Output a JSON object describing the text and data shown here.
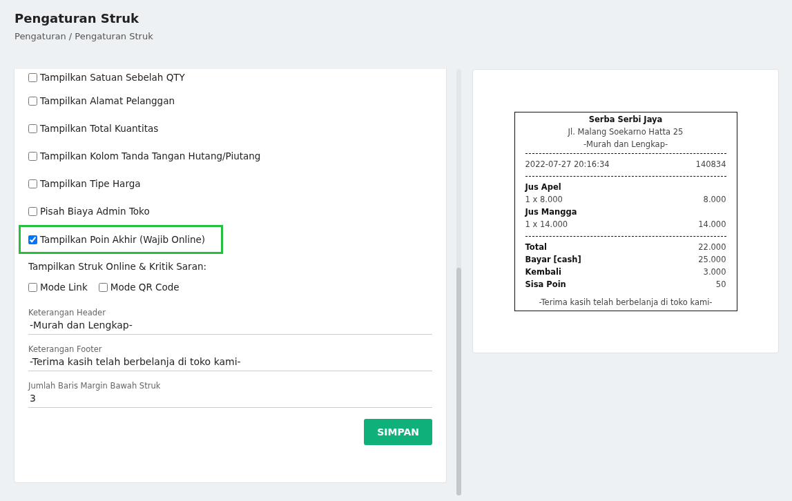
{
  "page": {
    "title": "Pengaturan Struk",
    "breadcrumb": "Pengaturan / Pengaturan Struk"
  },
  "options": [
    {
      "label": "Tampilkan Satuan Sebelah QTY",
      "checked": false,
      "highlighted": false
    },
    {
      "label": "Tampilkan Alamat Pelanggan",
      "checked": false,
      "highlighted": false
    },
    {
      "label": "Tampilkan Total Kuantitas",
      "checked": false,
      "highlighted": false
    },
    {
      "label": "Tampilkan Kolom Tanda Tangan Hutang/Piutang",
      "checked": false,
      "highlighted": false
    },
    {
      "label": "Tampilkan Tipe Harga",
      "checked": false,
      "highlighted": false
    },
    {
      "label": "Pisah Biaya Admin Toko",
      "checked": false,
      "highlighted": false
    },
    {
      "label": "Tampilkan Poin Akhir (Wajib Online)",
      "checked": true,
      "highlighted": true
    }
  ],
  "online_section": {
    "label": "Tampilkan Struk Online & Kritik Saran:",
    "modes": [
      {
        "label": "Mode Link",
        "checked": false
      },
      {
        "label": "Mode QR Code",
        "checked": false
      }
    ]
  },
  "fields": [
    {
      "label": "Keterangan Header",
      "value": "-Murah dan Lengkap-"
    },
    {
      "label": "Keterangan Footer",
      "value": "-Terima kasih telah berbelanja di toko kami-"
    },
    {
      "label": "Jumlah Baris Margin Bawah Struk",
      "value": "3"
    }
  ],
  "save_button": "SIMPAN",
  "receipt": {
    "store_name": "Serba Serbi Jaya",
    "address": "Jl. Malang Soekarno Hatta 25",
    "header_note": "-Murah dan Lengkap-",
    "datetime": "2022-07-27 20:16:34",
    "number": "140834",
    "items": [
      {
        "name": "Jus Apel",
        "qty_price": "1 x 8.000",
        "subtotal": "8.000"
      },
      {
        "name": "Jus Mangga",
        "qty_price": "1 x 14.000",
        "subtotal": "14.000"
      }
    ],
    "summary": [
      {
        "label": "Total",
        "value": "22.000"
      },
      {
        "label": "Bayar [cash]",
        "value": "25.000"
      },
      {
        "label": "Kembali",
        "value": "3.000"
      },
      {
        "label": "Sisa Poin",
        "value": "50"
      }
    ],
    "footer_note": "-Terima kasih telah berbelanja di toko kami-"
  }
}
